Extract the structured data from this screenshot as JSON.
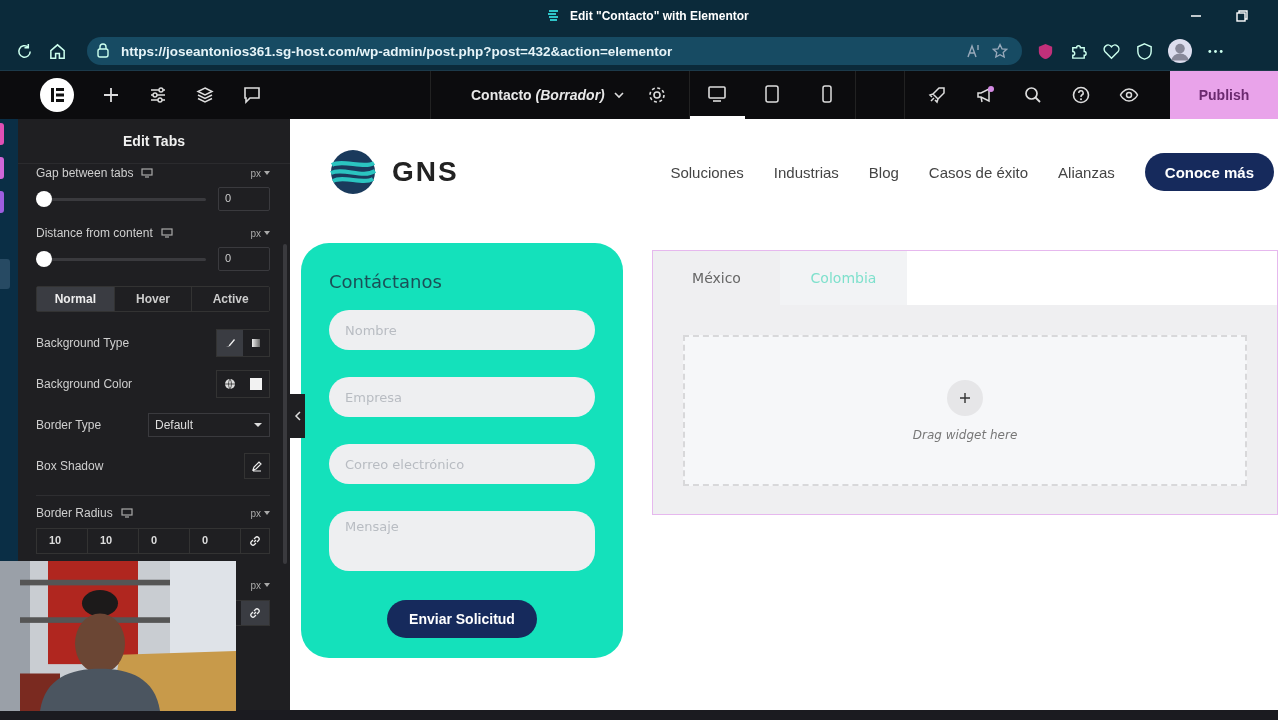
{
  "window": {
    "title": "Edit \"Contacto\" with Elementor"
  },
  "browser": {
    "url": "https://joseantonios361.sg-host.com/wp-admin/post.php?post=432&action=elementor"
  },
  "editor_toolbar": {
    "document": "Contacto",
    "status": "(Borrador)",
    "devices": [
      {
        "kind": "desktop",
        "selected": true
      },
      {
        "kind": "tablet",
        "selected": false
      },
      {
        "kind": "mobile",
        "selected": false
      }
    ],
    "publish": "Publish"
  },
  "panel": {
    "title": "Edit Tabs",
    "controls": [
      {
        "kind": "slider",
        "label": "Gap between tabs",
        "unit": "px",
        "level": 0,
        "value": "0"
      },
      {
        "kind": "slider",
        "label": "Distance from content",
        "unit": "px",
        "level": 0,
        "value": "0"
      },
      {
        "kind": "states",
        "tabs": [
          {
            "label": "Normal",
            "selected": true
          },
          {
            "label": "Hover",
            "selected": false
          },
          {
            "label": "Active",
            "selected": false
          }
        ]
      },
      {
        "kind": "choice",
        "label": "Background Type",
        "options": [
          {
            "kind": "brush",
            "selected": true
          },
          {
            "kind": "gradient",
            "selected": false
          }
        ]
      },
      {
        "kind": "color",
        "label": "Background Color"
      },
      {
        "kind": "select",
        "label": "Border Type",
        "value": "Default"
      },
      {
        "kind": "edit",
        "label": "Box Shadow"
      },
      {
        "kind": "dimensions",
        "label": "Border Radius",
        "unit": "px",
        "values": [
          "10",
          "10",
          "0",
          "0"
        ]
      },
      {
        "kind": "unit_row",
        "unit": "px"
      }
    ]
  },
  "page": {
    "logo": "GNS",
    "nav": [
      "Soluciones",
      "Industrias",
      "Blog",
      "Casos de éxito",
      "Alianzas"
    ],
    "cta": "Conoce más",
    "form": {
      "title": "Contáctanos",
      "fields": [
        {
          "kind": "input",
          "placeholder": "Nombre"
        },
        {
          "kind": "input",
          "placeholder": "Empresa"
        },
        {
          "kind": "input",
          "placeholder": "Correo electrónico"
        },
        {
          "kind": "textarea",
          "placeholder": "Mensaje"
        }
      ],
      "submit": "Enviar Solicitud"
    },
    "tabs": [
      {
        "label": "México",
        "selected": false
      },
      {
        "label": "Colombia",
        "selected": true
      }
    ],
    "dropzone": "Drag widget here"
  }
}
